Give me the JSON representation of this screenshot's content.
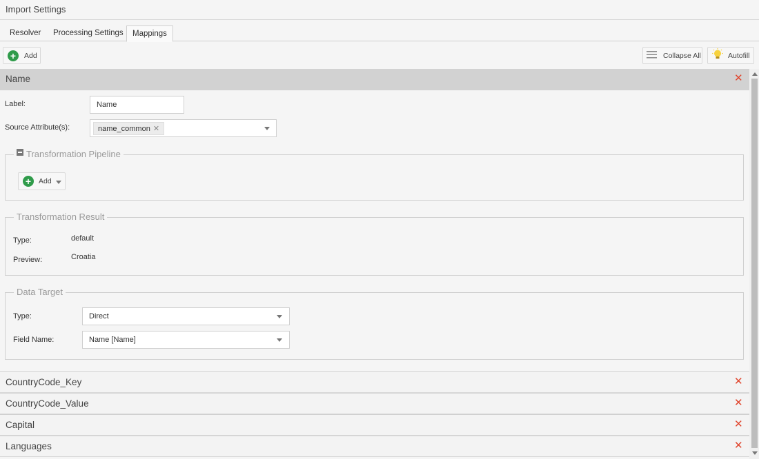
{
  "window": {
    "title": "Import Settings"
  },
  "tabs": [
    {
      "label": "Resolver"
    },
    {
      "label": "Processing Settings"
    },
    {
      "label": "Mappings"
    }
  ],
  "toolbar": {
    "add_label": "Add",
    "collapse_all_label": "Collapse All",
    "autofill_label": "Autofill"
  },
  "mapping": {
    "header": "Name",
    "label_caption": "Label:",
    "label_value": "Name",
    "source_caption": "Source Attribute(s):",
    "source_tag": "name_common",
    "pipeline": {
      "legend": "Transformation Pipeline",
      "add_label": "Add"
    },
    "result": {
      "legend": "Transformation Result",
      "type_caption": "Type:",
      "type_value": "default",
      "preview_caption": "Preview:",
      "preview_value": "Croatia"
    },
    "target": {
      "legend": "Data Target",
      "type_caption": "Type:",
      "type_value": "Direct",
      "field_caption": "Field Name:",
      "field_value": "Name [Name]"
    }
  },
  "collapsed_sections": [
    {
      "label": "CountryCode_Key"
    },
    {
      "label": "CountryCode_Value"
    },
    {
      "label": "Capital"
    },
    {
      "label": "Languages"
    }
  ],
  "icons": {
    "add": "plus-circle-icon",
    "collapse": "lines-icon",
    "autofill": "lightbulb-icon",
    "remove": "close-icon"
  },
  "colors": {
    "accent_green": "#2f9b4a",
    "remove_red": "#e0442c",
    "header_gray": "#d2d2d2"
  }
}
